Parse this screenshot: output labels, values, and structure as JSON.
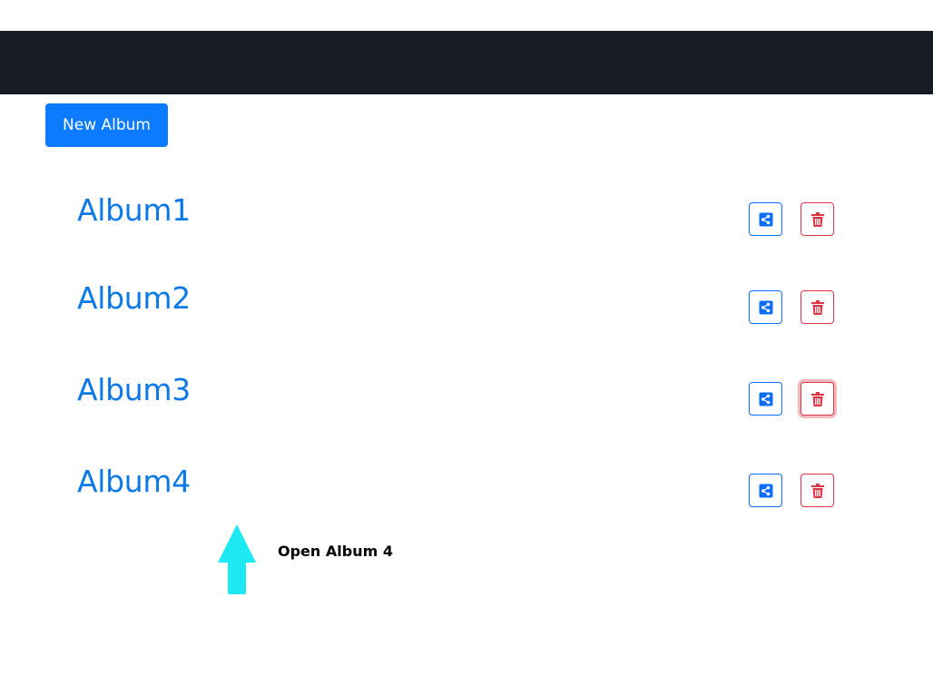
{
  "toolbar": {
    "new_album_label": "New Album"
  },
  "albums": [
    {
      "title": "Album1",
      "share_icon": "share-icon",
      "delete_icon": "trash-icon"
    },
    {
      "title": "Album2",
      "share_icon": "share-icon",
      "delete_icon": "trash-icon"
    },
    {
      "title": "Album3",
      "share_icon": "share-icon",
      "delete_icon": "trash-icon"
    },
    {
      "title": "Album4",
      "share_icon": "share-icon",
      "delete_icon": "trash-icon"
    }
  ],
  "annotation": {
    "text": "Open Album 4",
    "arrow_icon": "arrow-up-icon"
  },
  "colors": {
    "navbar": "#171c24",
    "primary": "#0d7bff",
    "link": "#0d79e6",
    "danger": "#dc3545",
    "annotation_arrow": "#1de9f2"
  }
}
